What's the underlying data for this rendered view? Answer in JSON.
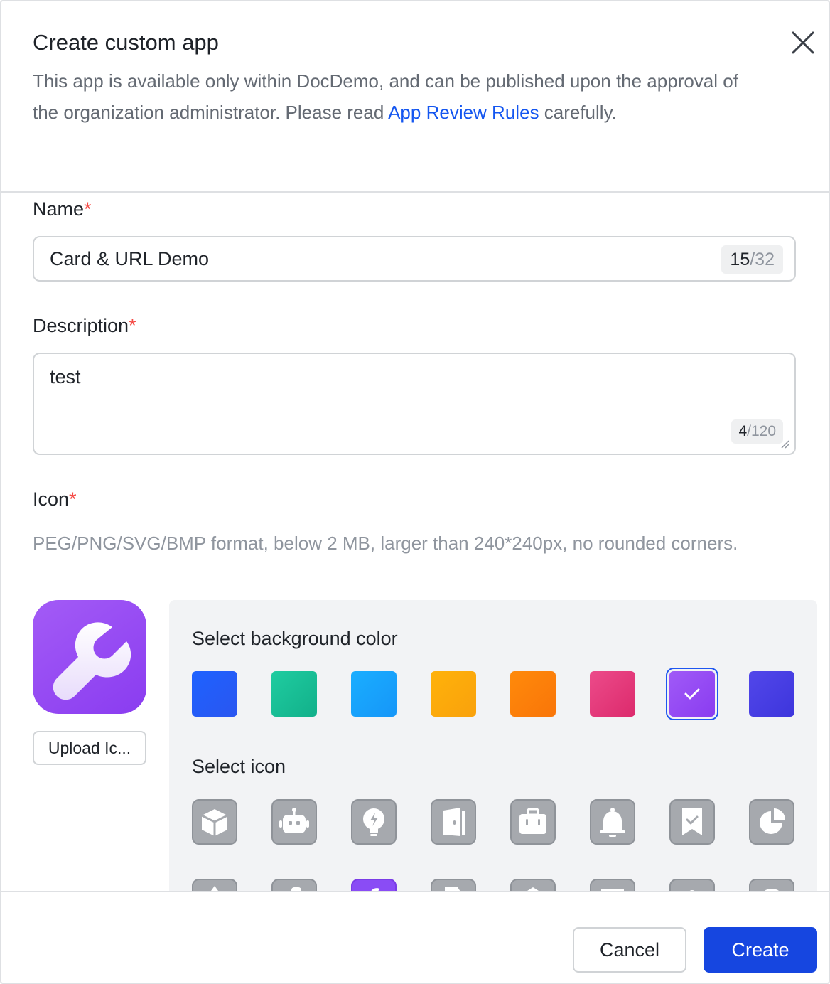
{
  "dialog": {
    "title": "Create custom app",
    "subtitle_before": "This app is available only within DocDemo, and can be published upon the approval of the organization administrator. Please read ",
    "subtitle_link": "App Review Rules",
    "subtitle_after": " carefully."
  },
  "form": {
    "name": {
      "label": "Name",
      "required": "*",
      "value": "Card & URL Demo",
      "count": "15",
      "max": "/32"
    },
    "description": {
      "label": "Description",
      "required": "*",
      "value": "test",
      "count": "4",
      "max": "/120"
    },
    "icon": {
      "label": "Icon",
      "required": "*",
      "hint": "PEG/PNG/SVG/BMP format, below 2 MB, larger than 240*240px, no rounded corners.",
      "upload_label": "Upload Ic..."
    }
  },
  "picker": {
    "bg_title": "Select background color",
    "icon_title": "Select icon",
    "colors": [
      {
        "name": "blue",
        "from": "#1e62ff",
        "to": "#2a56f0"
      },
      {
        "name": "green",
        "from": "#1fcca0",
        "to": "#12b08a"
      },
      {
        "name": "sky",
        "from": "#1aaeff",
        "to": "#1696f8"
      },
      {
        "name": "yellow",
        "from": "#ffb20a",
        "to": "#f9a10c"
      },
      {
        "name": "orange",
        "from": "#ff8a0a",
        "to": "#f97509"
      },
      {
        "name": "pink",
        "from": "#ec4b8a",
        "to": "#dc2a6c"
      },
      {
        "name": "purple",
        "from": "#a05af7",
        "to": "#8a3cf0"
      },
      {
        "name": "indigo",
        "from": "#5247ea",
        "to": "#3d35dc"
      }
    ],
    "selected_color": "purple",
    "icons": [
      "cube-icon",
      "robot-icon",
      "lightbulb-icon",
      "door-icon",
      "briefcase-icon",
      "bell-icon",
      "bookmark-check-icon",
      "pie-chart-icon"
    ]
  },
  "footer": {
    "cancel_label": "Cancel",
    "create_label": "Create"
  },
  "theme": {
    "primary": "#1646e0",
    "link": "#1456f0",
    "required": "#f54a45"
  }
}
